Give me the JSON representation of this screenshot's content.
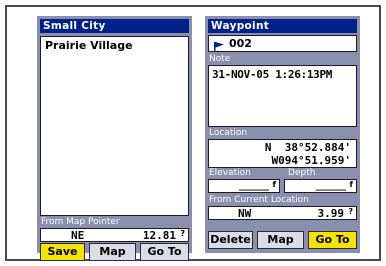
{
  "left_panel": {
    "title": "Small City",
    "name": "Prairie Village",
    "pointer_caption": "From Map Pointer",
    "direction": "NE",
    "distance": "12.81",
    "buttons": {
      "save": "Save",
      "map": "Map",
      "goto": "Go To"
    }
  },
  "right_panel": {
    "title": "Waypoint",
    "waypoint_id": "002",
    "note_caption": "Note",
    "note": "31-NOV-05 1:26:13PM",
    "location_caption": "Location",
    "lat": "N  38°52.884'",
    "lon": "W094°51.959'",
    "elevation_caption": "Elevation",
    "depth_caption": "Depth",
    "elevation_value": "_____",
    "depth_value": "_____",
    "current_caption": "From Current Location",
    "direction": "NW",
    "distance": "3.99",
    "buttons": {
      "delete": "Delete",
      "map": "Map",
      "goto": "Go To"
    }
  },
  "colors": {
    "panel_bg": "#8a8fae",
    "title_bg": "#00208a",
    "active_button": "#f4e400"
  },
  "icons": {
    "waypoint_symbol": "blue-flag-icon"
  }
}
